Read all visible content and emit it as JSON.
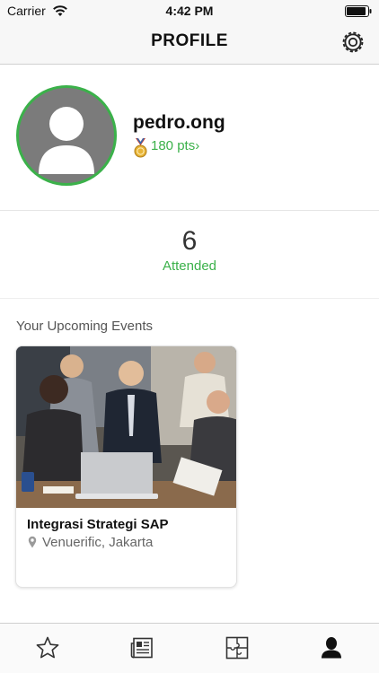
{
  "status_bar": {
    "carrier": "Carrier",
    "time": "4:42 PM"
  },
  "nav": {
    "title": "PROFILE",
    "settings_icon": "gear-icon"
  },
  "profile": {
    "username": "pedro.ong",
    "points": "180 pts",
    "points_chevron": "›",
    "accent_color": "#3bb14a"
  },
  "stats": {
    "count": "6",
    "label": "Attended"
  },
  "upcoming": {
    "heading": "Your Upcoming Events",
    "events": [
      {
        "title": "Integrasi Strategi SAP",
        "venue": "Venuerific, Jakarta",
        "image": "business-meeting-photo"
      }
    ]
  },
  "tab_bar": {
    "tabs": [
      {
        "icon": "star-icon",
        "active": false
      },
      {
        "icon": "newspaper-icon",
        "active": false
      },
      {
        "icon": "puzzle-icon",
        "active": false
      },
      {
        "icon": "user-icon",
        "active": true
      }
    ]
  }
}
